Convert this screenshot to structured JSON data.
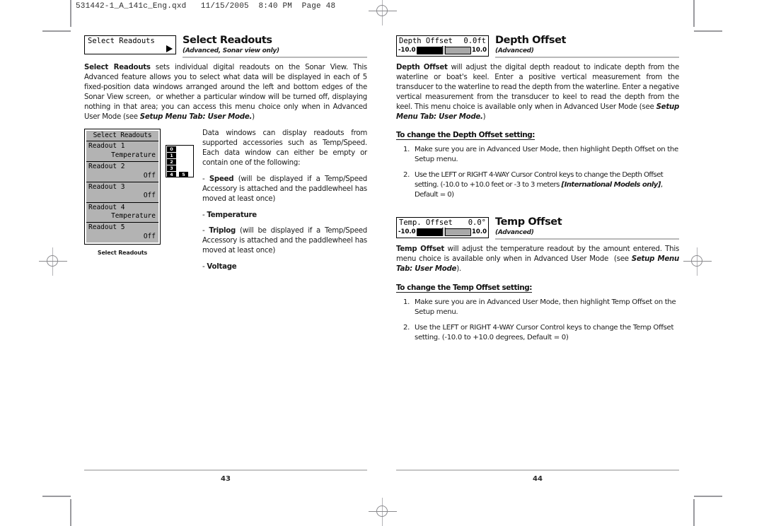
{
  "document": {
    "slug": "531442-1_A_141c_Eng.qxd   11/15/2005  8:40 PM  Page 48"
  },
  "left_page": {
    "folio": "43",
    "section": {
      "lcd_chip_label": "Select Readouts",
      "title": "Select Readouts",
      "subtitle": "(Advanced, Sonar view only)"
    },
    "intro_html": "<b>Select Readouts</b> sets individual digital readouts on the Sonar View. This Advanced feature allows you to select what data will be displayed in each of 5 fixed-position data windows arranged around the left and bottom edges of the Sonar View screen,&nbsp; or whether a particular window will be turned off, displaying nothing in that area; you can access this menu choice only when in Advanced User Mode (see <span class='bi'>Setup Menu Tab: User Mode.</span>)",
    "figure": {
      "menu_title": "Select Readouts",
      "rows": [
        {
          "name": "Readout 1",
          "value": "Temperature"
        },
        {
          "name": "Readout 2",
          "value": "Off"
        },
        {
          "name": "Readout 3",
          "value": "Off"
        },
        {
          "name": "Readout 4",
          "value": "Temperature"
        },
        {
          "name": "Readout 5",
          "value": "Off"
        }
      ],
      "caption": "Select Readouts",
      "window_cells": [
        "0",
        "1",
        "2",
        "3",
        "4",
        "5"
      ]
    },
    "side": {
      "paragraph": "Data windows can display readouts from supported accessories such as Temp/Speed. Each data window can either be empty or contain one of the following:",
      "bullets": [
        {
          "term": "Speed",
          "rest": " (will be displayed if a Temp/Speed Accessory is attached and the paddlewheel has moved at least once)"
        },
        {
          "term": "Temperature",
          "rest": ""
        },
        {
          "term": "Triplog",
          "rest": " (will be displayed if a Temp/Speed Accessory is attached and the paddlewheel has moved at least once)"
        },
        {
          "term": "Voltage",
          "rest": ""
        }
      ]
    }
  },
  "right_page": {
    "folio": "44",
    "depth": {
      "chip": {
        "label": "Depth Offset",
        "value": "0.0ft",
        "min": "-10.0",
        "max": "10.0",
        "fill_percent": 47
      },
      "title": "Depth Offset",
      "subtitle": "(Advanced)",
      "body_html": "<b>Depth Offset</b> will adjust the digital depth readout to indicate depth from the waterline or boat's keel. Enter a positive vertical measurement from the transducer to the waterline to read the depth from the waterline. Enter a negative vertical measurement from the transducer to keel to read the depth from the keel. This menu choice is available only when in Advanced User Mode (see <span class='bi'>Setup Menu Tab: User Mode.</span>)",
      "sub_head": "To change the Depth Offset setting:",
      "steps_html": [
        "Make sure you are in Advanced User Mode, then highlight Depth Offset on the Setup menu.",
        "<span class='tight'>Use the LEFT or RIGHT 4-WAY Cursor Control keys to change the Depth Offset setting. (-10.0 to +10.0 feet or -3 to 3 meters <span class='bi'>[International Models only]</span>, Default = 0)</span>"
      ]
    },
    "temp": {
      "chip": {
        "label": "Temp. Offset",
        "value": "0.0°",
        "min": "-10.0",
        "max": "10.0",
        "fill_percent": 47
      },
      "title": "Temp Offset",
      "subtitle": "(Advanced)",
      "body_html": "<b>Temp Offset</b> will adjust the temperature readout by the amount entered. This menu choice is available only when in Advanced User Mode&nbsp; (see <span class='bi'>Setup Menu Tab: User Mode</span>).",
      "sub_head": "To change the Temp Offset setting:",
      "steps_html": [
        "Make sure you are in Advanced User Mode, then highlight Temp Offset on the Setup menu.",
        "Use the LEFT or RIGHT 4-WAY Cursor Control keys to change the Temp Offset setting. (-10.0 to +10.0 degrees, Default = 0)"
      ]
    }
  }
}
